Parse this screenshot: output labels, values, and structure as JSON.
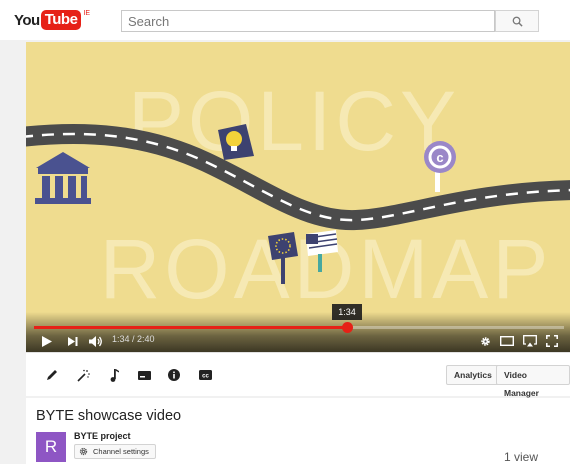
{
  "masthead": {
    "logo_you": "You",
    "logo_tube": "Tube",
    "logo_region": "IE",
    "search_placeholder": "Search"
  },
  "player": {
    "background_words": [
      "POLICY",
      "ROADMAP"
    ],
    "hover_time": "1:34",
    "time_display": "1:34 / 2:40",
    "progress": 0.59,
    "colors": {
      "background": "#efdc8f",
      "progress": "#e62117",
      "road": "#4b4b4b"
    }
  },
  "actionbar": {
    "tools": [
      "pencil-icon",
      "magic-wand-icon",
      "music-icon",
      "annotations-icon",
      "info-icon",
      "cc-icon"
    ],
    "analytics_label": "Analytics",
    "video_manager_label": "Video Manager"
  },
  "info": {
    "title": "BYTE showcase video",
    "avatar_letter": "R",
    "channel_name": "BYTE project",
    "channel_settings_label": "Channel settings",
    "views": "1 view"
  }
}
